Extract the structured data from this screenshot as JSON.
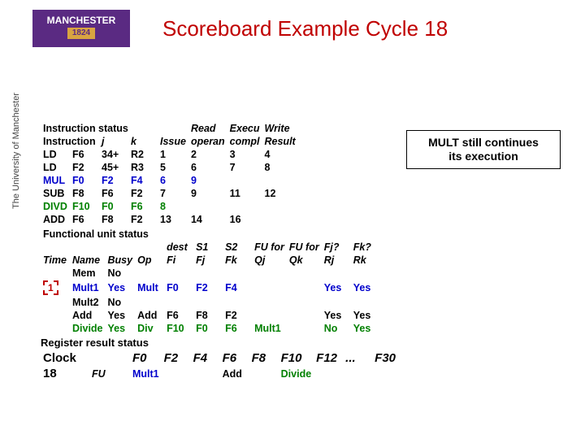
{
  "logo": {
    "name": "MANCHESTER",
    "year": "1824",
    "sidebar_text": "The University of Manchester"
  },
  "title": "Scoreboard Example Cycle 18",
  "note": {
    "line1": "MULT still continues",
    "line2": "its execution"
  },
  "inst_header": {
    "h0": "Instruction status",
    "h1": "Read",
    "h2": "Execu",
    "h3": "Write",
    "r0": "Instruction",
    "r1": "j",
    "r2": "k",
    "r3": "Issue",
    "r4": "operan",
    "r5": "compl",
    "r6": "Result"
  },
  "inst": [
    {
      "op": "LD",
      "dest": "F6",
      "j": "34+",
      "k": "R2",
      "issue": "1",
      "read": "2",
      "exec": "3",
      "write": "4",
      "color": ""
    },
    {
      "op": "LD",
      "dest": "F2",
      "j": "45+",
      "k": "R3",
      "issue": "5",
      "read": "6",
      "exec": "7",
      "write": "8",
      "color": ""
    },
    {
      "op": "MUL",
      "dest": "F0",
      "j": "F2",
      "k": "F4",
      "issue": "6",
      "read": "9",
      "exec": "",
      "write": "",
      "color": "blue"
    },
    {
      "op": "SUB",
      "dest": "F8",
      "j": "F6",
      "k": "F2",
      "issue": "7",
      "read": "9",
      "exec": "11",
      "write": "12",
      "color": ""
    },
    {
      "op": "DIVD",
      "dest": "F10",
      "j": "F0",
      "k": "F6",
      "issue": "8",
      "read": "",
      "exec": "",
      "write": "",
      "color": "green"
    },
    {
      "op": "ADD",
      "dest": "F6",
      "j": "F8",
      "k": "F2",
      "issue": "13",
      "read": "14",
      "exec": "16",
      "write": "",
      "color": ""
    }
  ],
  "fu_header": {
    "h0": "Functional unit status",
    "c_time": "Time",
    "c_name": "Name",
    "c_busy": "Busy",
    "c_op": "Op",
    "c_dest_h": "dest",
    "c_s1_h": "S1",
    "c_s2_h": "S2",
    "c_fu1_h": "FU for",
    "c_fu2_h": "FU for",
    "c_fj_h": "Fj?",
    "c_fk_h": "Fk?",
    "c_fi": "Fi",
    "c_fj": "Fj",
    "c_fk": "Fk",
    "c_qj": "Qj",
    "c_qk": "Qk",
    "c_rj": "Rj",
    "c_rk": "Rk"
  },
  "cycle_marker": "1",
  "fu": [
    {
      "time": "",
      "name": "Mem",
      "busy": "No",
      "op": "",
      "fi": "",
      "fj": "",
      "fk": "",
      "qj": "",
      "qk": "",
      "rj": "",
      "rk": "",
      "color": ""
    },
    {
      "time": "",
      "name": "Mult1",
      "busy": "Yes",
      "op": "Mult",
      "fi": "F0",
      "fj": "F2",
      "fk": "F4",
      "qj": "",
      "qk": "",
      "rj": "Yes",
      "rk": "Yes",
      "color": "blue"
    },
    {
      "time": "",
      "name": "Mult2",
      "busy": "No",
      "op": "",
      "fi": "",
      "fj": "",
      "fk": "",
      "qj": "",
      "qk": "",
      "rj": "",
      "rk": "",
      "color": ""
    },
    {
      "time": "",
      "name": "Add",
      "busy": "Yes",
      "op": "Add",
      "fi": "F6",
      "fj": "F8",
      "fk": "F2",
      "qj": "",
      "qk": "",
      "rj": "Yes",
      "rk": "Yes",
      "color": ""
    },
    {
      "time": "",
      "name": "Divide",
      "busy": "Yes",
      "op": "Div",
      "fi": "F10",
      "fj": "F0",
      "fk": "F6",
      "qj": "Mult1",
      "qk": "",
      "rj": "No",
      "rk": "Yes",
      "color": "green"
    }
  ],
  "reg_header": {
    "h0": "Register result status"
  },
  "clock_label": "Clock",
  "clock_value": "18",
  "fu_label": "FU",
  "reg_cols": [
    "F0",
    "F2",
    "F4",
    "F6",
    "F8",
    "F10",
    "F12",
    "...",
    "F30"
  ],
  "reg_vals": [
    "Mult1",
    "",
    "",
    "Add",
    "",
    "Divide",
    "",
    "",
    ""
  ]
}
